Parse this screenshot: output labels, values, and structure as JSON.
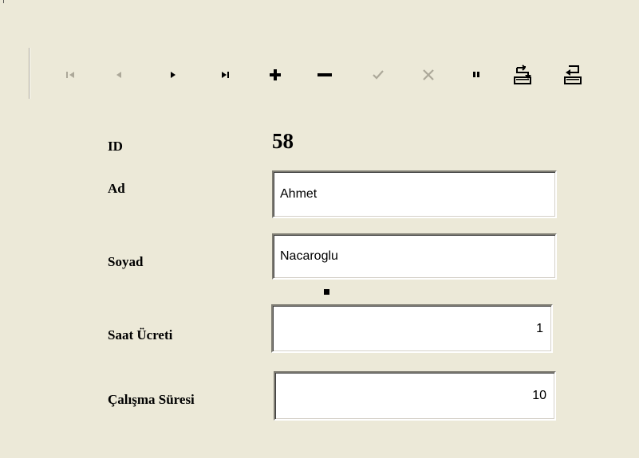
{
  "navigator": {
    "buttons": [
      {
        "name": "first-record",
        "icon": "first-record-icon",
        "enabled": false
      },
      {
        "name": "prior-record",
        "icon": "prior-record-icon",
        "enabled": false
      },
      {
        "name": "next-record",
        "icon": "next-record-icon",
        "enabled": true
      },
      {
        "name": "last-record",
        "icon": "last-record-icon",
        "enabled": true
      },
      {
        "name": "insert-record",
        "icon": "plus-icon",
        "enabled": true
      },
      {
        "name": "delete-record",
        "icon": "minus-icon",
        "enabled": true
      },
      {
        "name": "post-edit",
        "icon": "check-icon",
        "enabled": false
      },
      {
        "name": "cancel-edit",
        "icon": "x-icon",
        "enabled": false
      },
      {
        "name": "edit-record",
        "icon": "edit-icon",
        "enabled": true
      },
      {
        "name": "apply-updates",
        "icon": "apply-updates-icon",
        "enabled": true
      },
      {
        "name": "cancel-updates",
        "icon": "cancel-updates-icon",
        "enabled": true
      }
    ]
  },
  "form": {
    "id_label": "ID",
    "id_value": "58",
    "ad_label": "Ad",
    "ad_value": "Ahmet",
    "soyad_label": "Soyad",
    "soyad_value": "Nacaroglu",
    "saat_label": "Saat Ücreti",
    "saat_value": "1",
    "calisma_label": "Çalışma Süresi",
    "calisma_value": "10"
  },
  "colors": {
    "background": "#ECE9D8",
    "enabled_icon": "#000000",
    "disabled_icon": "#ACA899"
  }
}
